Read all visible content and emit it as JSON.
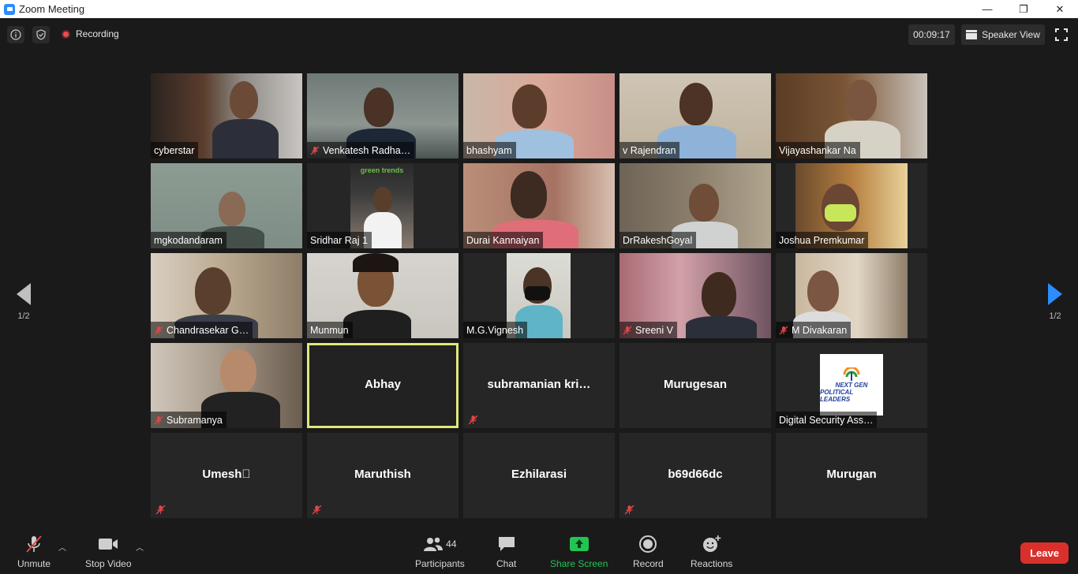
{
  "window": {
    "title": "Zoom Meeting",
    "minimize": "—",
    "restore": "❐",
    "close": "✕"
  },
  "topbar": {
    "recording_label": "Recording",
    "timer": "00:09:17",
    "view_label": "Speaker View"
  },
  "paging": {
    "left": "1/2",
    "right": "1/2"
  },
  "tiles": [
    {
      "name": "cyberstar",
      "muted": false
    },
    {
      "name": "Venkatesh Radha…",
      "muted": true
    },
    {
      "name": "bhashyam",
      "muted": false
    },
    {
      "name": "v Rajendran",
      "muted": false
    },
    {
      "name": "Vijayashankar Na",
      "muted": false
    },
    {
      "name": "mgkodandaram",
      "muted": false
    },
    {
      "name": "Sridhar Raj 1",
      "muted": false,
      "banner": "green trends"
    },
    {
      "name": "Durai Kannaiyan",
      "muted": false
    },
    {
      "name": "DrRakeshGoyal",
      "muted": false
    },
    {
      "name": "Joshua Premkumar",
      "muted": false
    },
    {
      "name": "Chandrasekar G…",
      "muted": true
    },
    {
      "name": "Munmun",
      "muted": false
    },
    {
      "name": "M.G.Vignesh",
      "muted": false
    },
    {
      "name": "Sreeni V",
      "muted": true
    },
    {
      "name": "M Divakaran",
      "muted": true
    },
    {
      "name": "Subramanya",
      "muted": true
    },
    {
      "name": "Abhay",
      "muted": false,
      "active_speaker": true
    },
    {
      "name": "subramanian  kri…",
      "muted": true
    },
    {
      "name": "Murugesan",
      "muted": false
    },
    {
      "name": "Digital Security Ass…",
      "muted": false,
      "logo_text": [
        "NEXT GEN",
        "POLITICAL LEADERS"
      ]
    },
    {
      "name": "Umesh⃞",
      "muted": true
    },
    {
      "name": "Maruthish",
      "muted": true
    },
    {
      "name": "Ezhilarasi",
      "muted": false
    },
    {
      "name": "b69d66dc",
      "muted": true
    },
    {
      "name": "Murugan",
      "muted": false
    }
  ],
  "toolbar": {
    "unmute": "Unmute",
    "stop_video": "Stop Video",
    "participants_count": "44",
    "participants": "Participants",
    "chat": "Chat",
    "share_screen": "Share Screen",
    "record": "Record",
    "reactions": "Reactions",
    "leave": "Leave"
  },
  "colors": {
    "accent_blue": "#2d8cff",
    "share_green": "#23c552",
    "leave_red": "#d9302c",
    "active_border": "#dfe87a",
    "muted_red": "#e04545"
  }
}
